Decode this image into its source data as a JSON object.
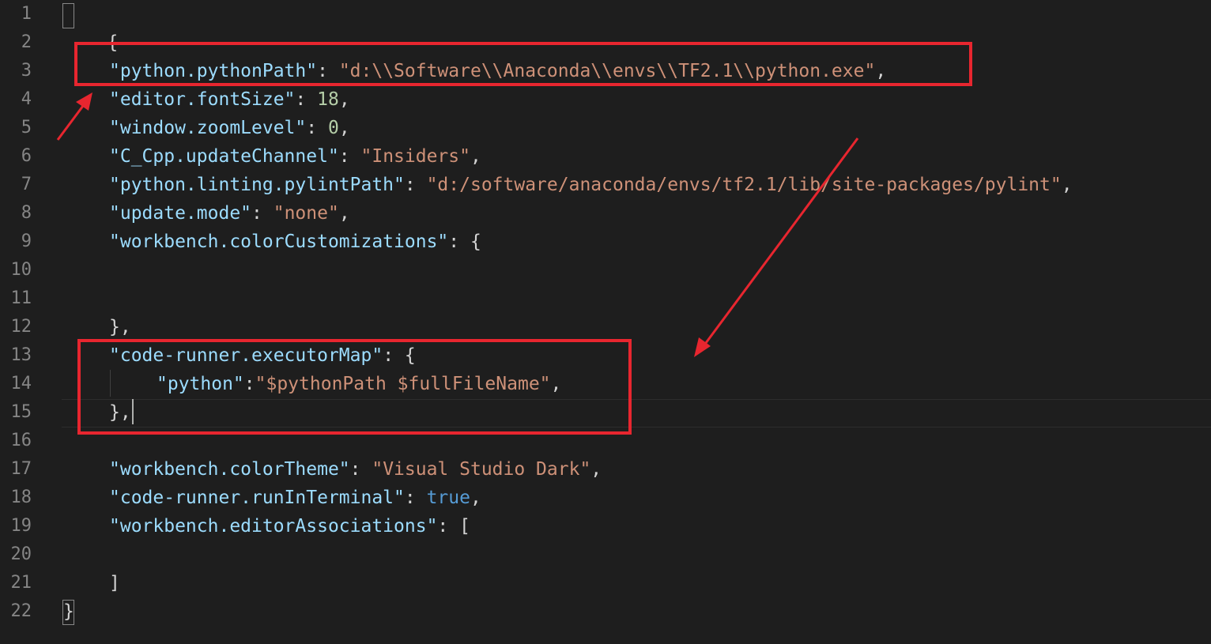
{
  "editor": {
    "line_numbers": [
      "1",
      "2",
      "3",
      "4",
      "5",
      "6",
      "7",
      "8",
      "9",
      "10",
      "11",
      "12",
      "13",
      "14",
      "15",
      "16",
      "17",
      "18",
      "19",
      "20",
      "21",
      "22"
    ],
    "lines": {
      "l1_open": "{",
      "l3_key": "\"python.pythonPath\"",
      "l3_colon": ": ",
      "l3_val": "\"d:\\\\Software\\\\Anaconda\\\\envs\\\\TF2.1\\\\python.exe\"",
      "l3_end": ",",
      "l4_key": "\"editor.fontSize\"",
      "l4_colon": ": ",
      "l4_val": "18",
      "l4_end": ",",
      "l5_key": "\"window.zoomLevel\"",
      "l5_colon": ": ",
      "l5_val": "0",
      "l5_end": ",",
      "l6_key": "\"C_Cpp.updateChannel\"",
      "l6_colon": ": ",
      "l6_val": "\"Insiders\"",
      "l6_end": ",",
      "l7_key": "\"python.linting.pylintPath\"",
      "l7_colon": ": ",
      "l7_val": "\"d:/software/anaconda/envs/tf2.1/lib/site-packages/pylint\"",
      "l7_end": ",",
      "l8_key": "\"update.mode\"",
      "l8_colon": ": ",
      "l8_val": "\"none\"",
      "l8_end": ",",
      "l9_key": "\"workbench.colorCustomizations\"",
      "l9_colon": ": ",
      "l9_open": "{",
      "l12_close": "},",
      "l13_key": "\"code-runner.executorMap\"",
      "l13_colon": ": ",
      "l13_open": "{",
      "l14_key": "\"python\"",
      "l14_colon": ":",
      "l14_val": "\"$pythonPath $fullFileName\"",
      "l14_end": ",",
      "l15_close": "},",
      "l17_key": "\"workbench.colorTheme\"",
      "l17_colon": ": ",
      "l17_val": "\"Visual Studio Dark\"",
      "l17_end": ",",
      "l18_key": "\"code-runner.runInTerminal\"",
      "l18_colon": ": ",
      "l18_val": "true",
      "l18_end": ",",
      "l19_key": "\"workbench.editorAssociations\"",
      "l19_colon": ": ",
      "l19_open": "[",
      "l21_close": "]",
      "l22_close": "}"
    }
  },
  "colors": {
    "background": "#1e1e1e",
    "key": "#9cdcfe",
    "string": "#ce9178",
    "number": "#b5cea8",
    "keyword": "#569cd6",
    "line_number": "#858585",
    "annotation": "#e8262f"
  }
}
